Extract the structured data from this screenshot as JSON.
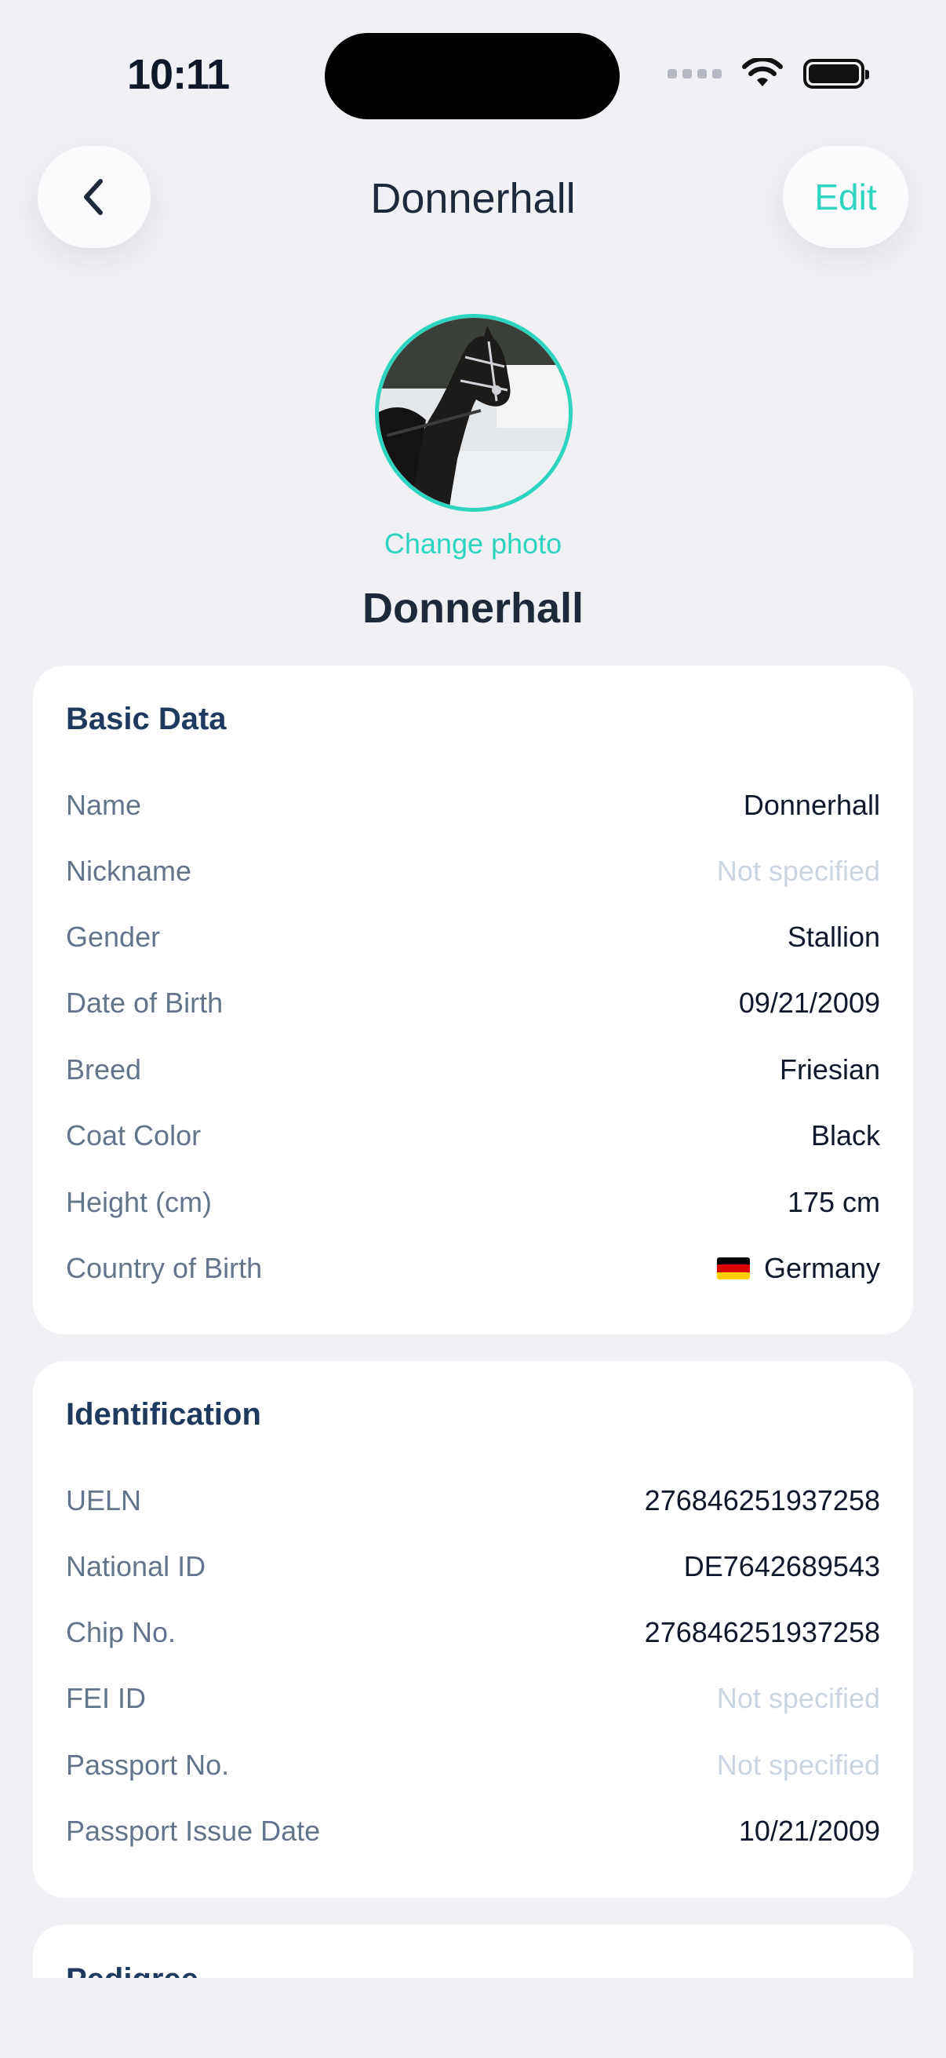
{
  "status_bar": {
    "time": "10:11"
  },
  "nav": {
    "back_icon": "chevron-left-icon",
    "title": "Donnerhall",
    "edit_label": "Edit"
  },
  "profile": {
    "change_photo_label": "Change photo",
    "name": "Donnerhall"
  },
  "basic_data": {
    "title": "Basic Data",
    "rows": [
      {
        "label": "Name",
        "value": "Donnerhall"
      },
      {
        "label": "Nickname",
        "value": "Not specified"
      },
      {
        "label": "Gender",
        "value": "Stallion"
      },
      {
        "label": "Date of Birth",
        "value": "09/21/2009"
      },
      {
        "label": "Breed",
        "value": "Friesian"
      },
      {
        "label": "Coat Color",
        "value": "Black"
      },
      {
        "label": "Height (cm)",
        "value": "175 cm"
      },
      {
        "label": "Country of Birth",
        "value": "Germany"
      }
    ]
  },
  "identification": {
    "title": "Identification",
    "rows": [
      {
        "label": "UELN",
        "value": "276846251937258"
      },
      {
        "label": "National ID",
        "value": "DE7642689543"
      },
      {
        "label": "Chip No.",
        "value": "276846251937258"
      },
      {
        "label": "FEI ID",
        "value": "Not specified"
      },
      {
        "label": "Passport No.",
        "value": "Not specified"
      },
      {
        "label": "Passport Issue Date",
        "value": "10/21/2009"
      }
    ]
  },
  "pedigree": {
    "title": "Pedigree"
  },
  "colors": {
    "accent": "#2dd4bf",
    "section_title": "#1e3a5f",
    "placeholder": "#cbd5e1"
  }
}
